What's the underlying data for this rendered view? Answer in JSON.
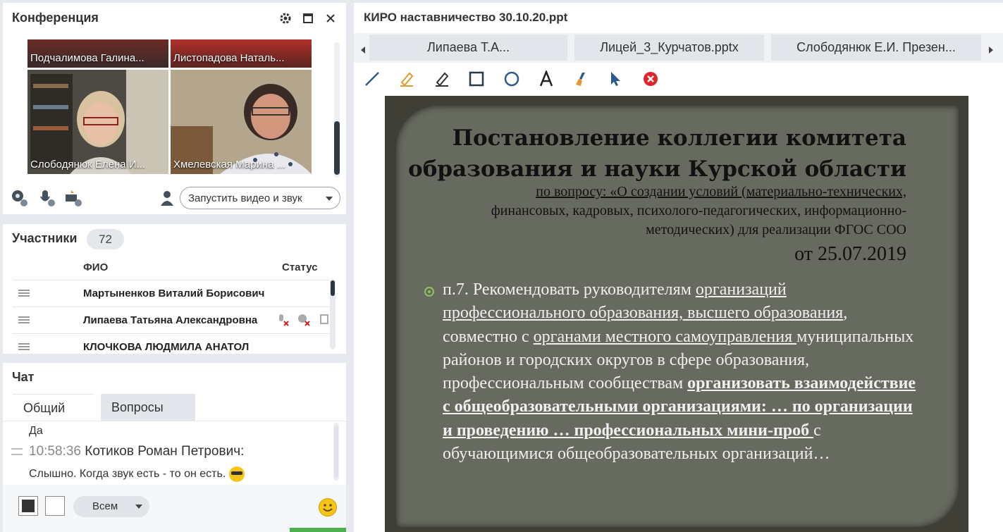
{
  "conference": {
    "title": "Конференция",
    "videos": [
      {
        "name": "Подчалимова  Галина..."
      },
      {
        "name": "Листопадова Наталь..."
      },
      {
        "name": "Слободянюк Елена  И..."
      },
      {
        "name": "Хмелевская Марина  ..."
      }
    ],
    "start_av_label": "Запустить видео и звук"
  },
  "participants": {
    "title": "Участники",
    "count": "72",
    "col_name": "ФИО",
    "col_status": "Статус",
    "rows": [
      {
        "name": "Мартыненков Виталий  Борисович"
      },
      {
        "name": "Липаева Татьяна  Александровна"
      },
      {
        "name": "КЛОЧКОВА ЛЮДМИЛА  АНАТОЛ"
      }
    ]
  },
  "chat": {
    "title": "Чат",
    "tabs": [
      "Общий",
      "Вопросы"
    ],
    "messages": {
      "prev_text": "Да",
      "time": "10:58:36",
      "author": "Котиков Роман Петрович:",
      "text": "Слышно. Когда звук есть - то он есть."
    },
    "recipient": "Всем"
  },
  "presentation": {
    "title": "КИРО наставничество  30.10.20.ppt",
    "doc_tabs": [
      "Липаева Т.А...",
      "Лицей_3_Курчатов.pptx",
      "Слободянюк Е.И. Презен..."
    ],
    "slide": {
      "title_line1": "Постановление коллегии комитета",
      "title_line2": "образования и науки Курской области",
      "subtitle_line1": "по вопросу: «О создании условий (материально-технических,",
      "subtitle_line2": "финансовых, кадровых, психолого-педагогических, информационно-",
      "subtitle_line3": "методических) для реализации ФГОС СОО",
      "date": "от 25.07.2019",
      "body": {
        "p1": "п.7. Рекомендовать руководителям ",
        "u1": "организаций профессионального образования, высшего образования",
        "p2": ", совместно с ",
        "u2": "органами местного самоуправления ",
        "p3": "муниципальных районов и городских округов в сфере образования, профессиональным сообществам ",
        "b1": "организовать взаимодействие с общеобразовательными организациями: … по организации и проведению … профессиональных мини-проб ",
        "p4": "с обучающимися общеобразовательных организаций…"
      }
    }
  },
  "colors": {
    "accent_green": "#4cb04f",
    "slide_bg": "#676b5f",
    "close_red": "#e0242c"
  }
}
